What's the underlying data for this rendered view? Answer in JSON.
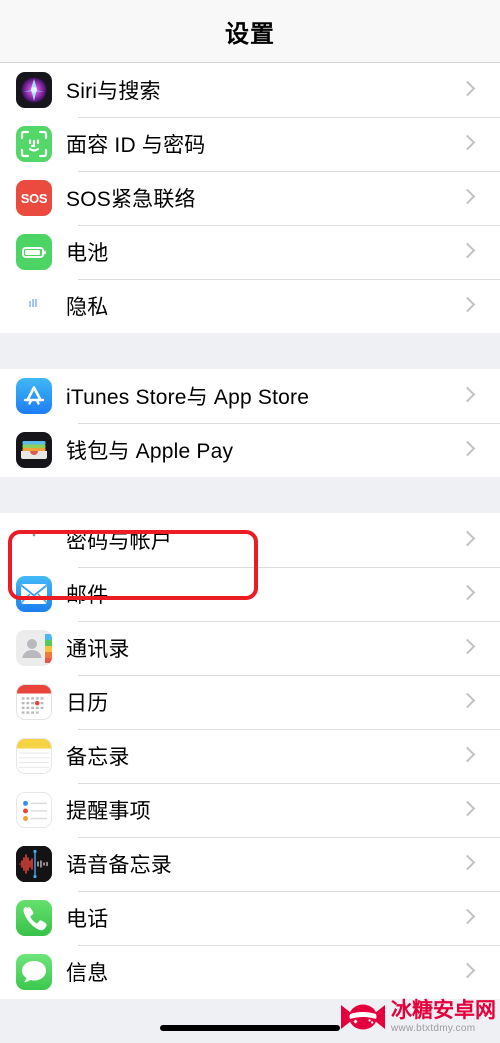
{
  "navbar": {
    "title": "设置"
  },
  "groups": [
    {
      "name": "group-system",
      "rows": [
        {
          "label": "Siri与搜索",
          "icon": "siri-icon",
          "name": "settings-row-siri-search"
        },
        {
          "label": "面容 ID 与密码",
          "icon": "faceid-icon",
          "name": "settings-row-face-id"
        },
        {
          "label": "SOS紧急联络",
          "icon": "sos-icon",
          "name": "settings-row-emergency-sos"
        },
        {
          "label": "电池",
          "icon": "battery-icon",
          "name": "settings-row-battery"
        },
        {
          "label": "隐私",
          "icon": "privacy-hand-icon",
          "name": "settings-row-privacy"
        }
      ]
    },
    {
      "name": "group-stores",
      "rows": [
        {
          "label": "iTunes Store与 App Store",
          "icon": "app-store-icon",
          "name": "settings-row-itunes-app-store"
        },
        {
          "label": "钱包与 Apple Pay",
          "icon": "wallet-icon",
          "name": "settings-row-wallet-apple-pay"
        }
      ]
    },
    {
      "name": "group-apps",
      "rows": [
        {
          "label": "密码与帐户",
          "icon": "key-icon",
          "name": "settings-row-passwords-accounts"
        },
        {
          "label": "邮件",
          "icon": "mail-icon",
          "name": "settings-row-mail"
        },
        {
          "label": "通讯录",
          "icon": "contacts-icon",
          "name": "settings-row-contacts"
        },
        {
          "label": "日历",
          "icon": "calendar-icon",
          "name": "settings-row-calendar"
        },
        {
          "label": "备忘录",
          "icon": "notes-icon",
          "name": "settings-row-notes"
        },
        {
          "label": "提醒事项",
          "icon": "reminders-icon",
          "name": "settings-row-reminders"
        },
        {
          "label": "语音备忘录",
          "icon": "voice-memos-icon",
          "name": "settings-row-voice-memos"
        },
        {
          "label": "电话",
          "icon": "phone-icon",
          "name": "settings-row-phone"
        },
        {
          "label": "信息",
          "icon": "messages-icon",
          "name": "settings-row-messages"
        }
      ]
    }
  ],
  "highlight": {
    "target_label": "密码与帐户",
    "color": "#ec1c24"
  },
  "sos_icon_text": "SOS",
  "watermark": {
    "name": "冰糖安卓网",
    "url": "www.btxtdmy.com",
    "color": "#e3003c"
  }
}
